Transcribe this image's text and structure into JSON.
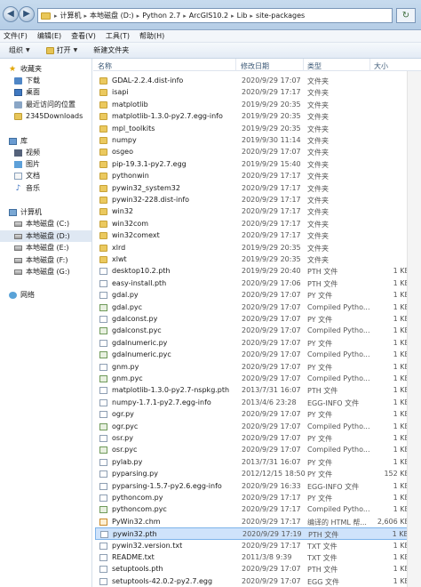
{
  "address": {
    "crumbs": [
      "计算机",
      "本地磁盘 (D:)",
      "Python 2.7",
      "ArcGIS10.2",
      "Lib",
      "site-packages"
    ]
  },
  "menu": [
    "文件(F)",
    "编辑(E)",
    "查看(V)",
    "工具(T)",
    "帮助(H)"
  ],
  "toolbar": {
    "organize": "组织",
    "open": "打开",
    "new_folder": "新建文件夹"
  },
  "nav": {
    "favorites": "收藏夹",
    "downloads": "下载",
    "desktop": "桌面",
    "recent": "最近访问的位置",
    "downloads2345": "2345Downloads",
    "library": "库",
    "videos": "视频",
    "pictures": "图片",
    "documents": "文档",
    "music": "音乐",
    "computer": "计算机",
    "drive_c": "本地磁盘 (C:)",
    "drive_d": "本地磁盘 (D:)",
    "drive_e": "本地磁盘 (E:)",
    "drive_f": "本地磁盘 (F:)",
    "drive_g": "本地磁盘 (G:)",
    "network": "网络"
  },
  "columns": {
    "name": "名称",
    "date": "修改日期",
    "type": "类型",
    "size": "大小"
  },
  "files": [
    {
      "name": "GDAL-2.2.4.dist-info",
      "date": "2020/9/29 17:07",
      "type": "文件夹",
      "size": "",
      "icon": "folder"
    },
    {
      "name": "isapi",
      "date": "2020/9/29 17:17",
      "type": "文件夹",
      "size": "",
      "icon": "folder"
    },
    {
      "name": "matplotlib",
      "date": "2019/9/29 20:35",
      "type": "文件夹",
      "size": "",
      "icon": "folder"
    },
    {
      "name": "matplotlib-1.3.0-py2.7.egg-info",
      "date": "2019/9/29 20:35",
      "type": "文件夹",
      "size": "",
      "icon": "folder"
    },
    {
      "name": "mpl_toolkits",
      "date": "2019/9/29 20:35",
      "type": "文件夹",
      "size": "",
      "icon": "folder"
    },
    {
      "name": "numpy",
      "date": "2019/9/30 11:14",
      "type": "文件夹",
      "size": "",
      "icon": "folder"
    },
    {
      "name": "osgeo",
      "date": "2020/9/29 17:07",
      "type": "文件夹",
      "size": "",
      "icon": "folder"
    },
    {
      "name": "pip-19.3.1-py2.7.egg",
      "date": "2019/9/29 15:40",
      "type": "文件夹",
      "size": "",
      "icon": "folder"
    },
    {
      "name": "pythonwin",
      "date": "2020/9/29 17:17",
      "type": "文件夹",
      "size": "",
      "icon": "folder"
    },
    {
      "name": "pywin32_system32",
      "date": "2020/9/29 17:17",
      "type": "文件夹",
      "size": "",
      "icon": "folder"
    },
    {
      "name": "pywin32-228.dist-info",
      "date": "2020/9/29 17:17",
      "type": "文件夹",
      "size": "",
      "icon": "folder"
    },
    {
      "name": "win32",
      "date": "2020/9/29 17:17",
      "type": "文件夹",
      "size": "",
      "icon": "folder"
    },
    {
      "name": "win32com",
      "date": "2020/9/29 17:17",
      "type": "文件夹",
      "size": "",
      "icon": "folder"
    },
    {
      "name": "win32comext",
      "date": "2020/9/29 17:17",
      "type": "文件夹",
      "size": "",
      "icon": "folder"
    },
    {
      "name": "xlrd",
      "date": "2019/9/29 20:35",
      "type": "文件夹",
      "size": "",
      "icon": "folder"
    },
    {
      "name": "xlwt",
      "date": "2019/9/29 20:35",
      "type": "文件夹",
      "size": "",
      "icon": "folder"
    },
    {
      "name": "desktop10.2.pth",
      "date": "2019/9/29 20:40",
      "type": "PTH 文件",
      "size": "1 KB",
      "icon": "file"
    },
    {
      "name": "easy-install.pth",
      "date": "2020/9/29 17:06",
      "type": "PTH 文件",
      "size": "1 KB",
      "icon": "file"
    },
    {
      "name": "gdal.py",
      "date": "2020/9/29 17:07",
      "type": "PY 文件",
      "size": "1 KB",
      "icon": "py"
    },
    {
      "name": "gdal.pyc",
      "date": "2020/9/29 17:07",
      "type": "Compiled Pytho...",
      "size": "1 KB",
      "icon": "pyc"
    },
    {
      "name": "gdalconst.py",
      "date": "2020/9/29 17:07",
      "type": "PY 文件",
      "size": "1 KB",
      "icon": "py"
    },
    {
      "name": "gdalconst.pyc",
      "date": "2020/9/29 17:07",
      "type": "Compiled Pytho...",
      "size": "1 KB",
      "icon": "pyc"
    },
    {
      "name": "gdalnumeric.py",
      "date": "2020/9/29 17:07",
      "type": "PY 文件",
      "size": "1 KB",
      "icon": "py"
    },
    {
      "name": "gdalnumeric.pyc",
      "date": "2020/9/29 17:07",
      "type": "Compiled Pytho...",
      "size": "1 KB",
      "icon": "pyc"
    },
    {
      "name": "gnm.py",
      "date": "2020/9/29 17:07",
      "type": "PY 文件",
      "size": "1 KB",
      "icon": "py"
    },
    {
      "name": "gnm.pyc",
      "date": "2020/9/29 17:07",
      "type": "Compiled Pytho...",
      "size": "1 KB",
      "icon": "pyc"
    },
    {
      "name": "matplotlib-1.3.0-py2.7-nspkg.pth",
      "date": "2013/7/31 16:07",
      "type": "PTH 文件",
      "size": "1 KB",
      "icon": "file"
    },
    {
      "name": "numpy-1.7.1-py2.7.egg-info",
      "date": "2013/4/6 23:28",
      "type": "EGG-INFO 文件",
      "size": "1 KB",
      "icon": "file"
    },
    {
      "name": "ogr.py",
      "date": "2020/9/29 17:07",
      "type": "PY 文件",
      "size": "1 KB",
      "icon": "py"
    },
    {
      "name": "ogr.pyc",
      "date": "2020/9/29 17:07",
      "type": "Compiled Pytho...",
      "size": "1 KB",
      "icon": "pyc"
    },
    {
      "name": "osr.py",
      "date": "2020/9/29 17:07",
      "type": "PY 文件",
      "size": "1 KB",
      "icon": "py"
    },
    {
      "name": "osr.pyc",
      "date": "2020/9/29 17:07",
      "type": "Compiled Pytho...",
      "size": "1 KB",
      "icon": "pyc"
    },
    {
      "name": "pylab.py",
      "date": "2013/7/31 16:07",
      "type": "PY 文件",
      "size": "1 KB",
      "icon": "py"
    },
    {
      "name": "pyparsing.py",
      "date": "2012/12/15 18:50",
      "type": "PY 文件",
      "size": "152 KB",
      "icon": "py"
    },
    {
      "name": "pyparsing-1.5.7-py2.6.egg-info",
      "date": "2020/9/29 16:33",
      "type": "EGG-INFO 文件",
      "size": "1 KB",
      "icon": "file"
    },
    {
      "name": "pythoncom.py",
      "date": "2020/9/29 17:17",
      "type": "PY 文件",
      "size": "1 KB",
      "icon": "py"
    },
    {
      "name": "pythoncom.pyc",
      "date": "2020/9/29 17:17",
      "type": "Compiled Pytho...",
      "size": "1 KB",
      "icon": "pyc"
    },
    {
      "name": "PyWin32.chm",
      "date": "2020/9/29 17:17",
      "type": "编译的 HTML 帮...",
      "size": "2,606 KB",
      "icon": "html"
    },
    {
      "name": "pywin32.pth",
      "date": "2020/9/29 17:19",
      "type": "PTH 文件",
      "size": "1 KB",
      "icon": "file",
      "selected": true
    },
    {
      "name": "pywin32.version.txt",
      "date": "2020/9/29 17:17",
      "type": "TXT 文件",
      "size": "1 KB",
      "icon": "file"
    },
    {
      "name": "README.txt",
      "date": "2011/3/8 9:39",
      "type": "TXT 文件",
      "size": "1 KB",
      "icon": "file"
    },
    {
      "name": "setuptools.pth",
      "date": "2020/9/29 17:07",
      "type": "PTH 文件",
      "size": "1 KB",
      "icon": "file"
    },
    {
      "name": "setuptools-42.0.2-py2.7.egg",
      "date": "2020/9/29 17:07",
      "type": "EGG 文件",
      "size": "1 KB",
      "icon": "file"
    }
  ]
}
